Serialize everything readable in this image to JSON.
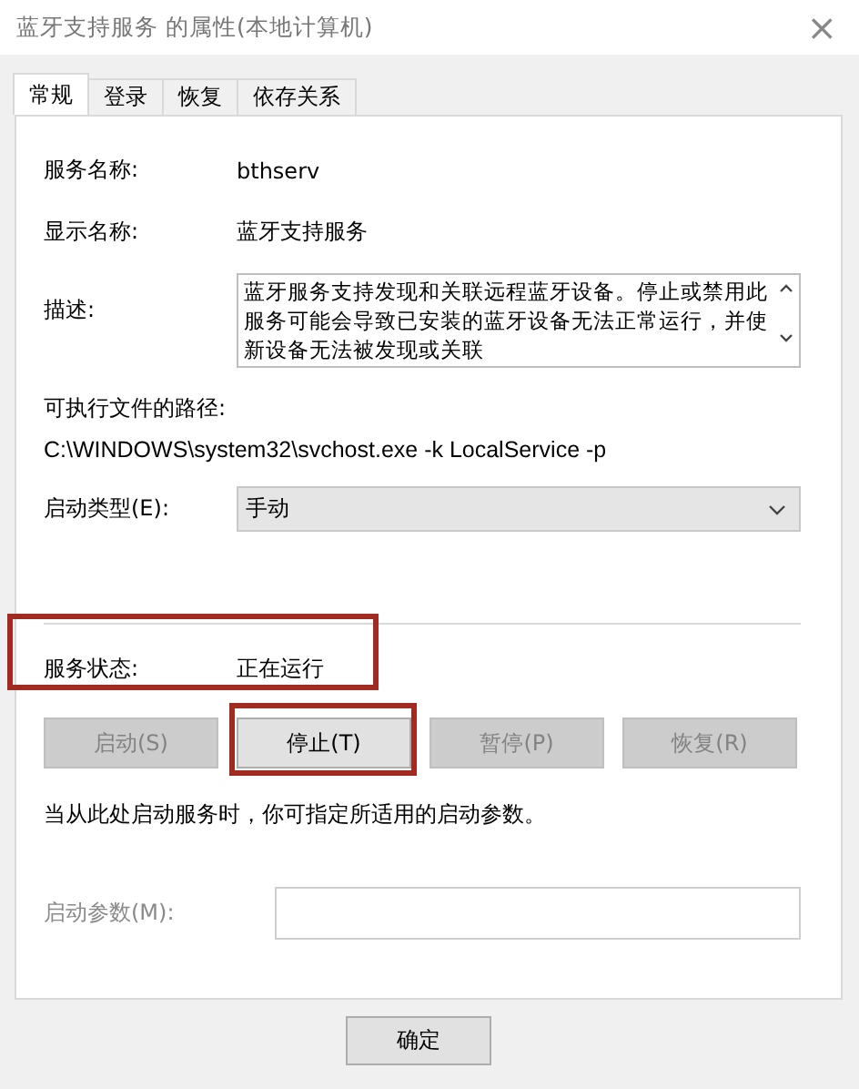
{
  "window": {
    "title": "蓝牙支持服务 的属性(本地计算机)",
    "close": "×"
  },
  "tabs": [
    {
      "label": "常规",
      "selected": true
    },
    {
      "label": "登录",
      "selected": false
    },
    {
      "label": "恢复",
      "selected": false
    },
    {
      "label": "依存关系",
      "selected": false
    }
  ],
  "service_name": {
    "label": "服务名称:",
    "value": "bthserv"
  },
  "display_name": {
    "label": "显示名称:",
    "value": "蓝牙支持服务"
  },
  "description": {
    "label": "描述:",
    "value": "蓝牙服务支持发现和关联远程蓝牙设备。停止或禁用此服务可能会导致已安装的蓝牙设备无法正常运行，并使新设备无法被发现或关联"
  },
  "executable_path": {
    "label": "可执行文件的路径:",
    "value": "C:\\WINDOWS\\system32\\svchost.exe -k LocalService -p"
  },
  "startup_type": {
    "label": "启动类型(E):",
    "value": "手动"
  },
  "service_status": {
    "label": "服务状态:",
    "value": "正在运行",
    "highlighted": true
  },
  "control_buttons": [
    {
      "label": "启动(S)",
      "disabled": true,
      "highlighted": false
    },
    {
      "label": "停止(T)",
      "disabled": false,
      "highlighted": true
    },
    {
      "label": "暂停(P)",
      "disabled": true,
      "highlighted": false
    },
    {
      "label": "恢复(R)",
      "disabled": true,
      "highlighted": false
    }
  ],
  "hint": "当从此处启动服务时，你可指定所适用的启动参数。",
  "start_parameters": {
    "label": "启动参数(M):",
    "disabled": true
  },
  "dialog_buttons": [
    {
      "label": "确定"
    }
  ]
}
